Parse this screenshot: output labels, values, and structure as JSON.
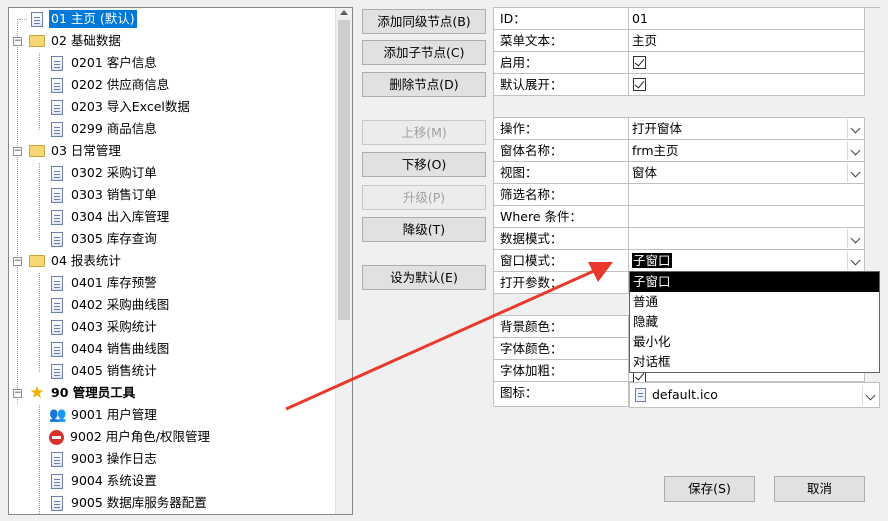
{
  "tree": {
    "nodes": [
      {
        "label": "01 主页 (默认)"
      },
      {
        "label": "02 基础数据"
      },
      {
        "label": "0201 客户信息"
      },
      {
        "label": "0202 供应商信息"
      },
      {
        "label": "0203 导入Excel数据"
      },
      {
        "label": "0299 商品信息"
      },
      {
        "label": "03 日常管理"
      },
      {
        "label": "0302 采购订单"
      },
      {
        "label": "0303 销售订单"
      },
      {
        "label": "0304 出入库管理"
      },
      {
        "label": "0305 库存查询"
      },
      {
        "label": "04 报表统计"
      },
      {
        "label": "0401 库存预警"
      },
      {
        "label": "0402 采购曲线图"
      },
      {
        "label": "0403 采购统计"
      },
      {
        "label": "0404 销售曲线图"
      },
      {
        "label": "0405 销售统计"
      },
      {
        "label": "90 管理员工具"
      },
      {
        "label": "9001 用户管理"
      },
      {
        "label": "9002 用户角色/权限管理"
      },
      {
        "label": "9003 操作日志"
      },
      {
        "label": "9004 系统设置"
      },
      {
        "label": "9005 数据库服务器配置"
      }
    ]
  },
  "buttons": {
    "add_sibling": "添加同级节点(B)",
    "add_child": "添加子节点(C)",
    "delete": "删除节点(D)",
    "move_up": "上移(M)",
    "move_down": "下移(O)",
    "promote": "升级(P)",
    "demote": "降级(T)",
    "set_default": "设为默认(E)"
  },
  "props": {
    "id_label": "ID：",
    "id_value": "01",
    "menu_text_label": "菜单文本：",
    "menu_text_value": "主页",
    "enabled_label": "启用：",
    "expand_label": "默认展开：",
    "operation_label": "操作：",
    "operation_value": "打开窗体",
    "form_name_label": "窗体名称：",
    "form_name_value": "frm主页",
    "view_label": "视图：",
    "view_value": "窗体",
    "filter_label": "筛选名称：",
    "where_label": "Where 条件：",
    "data_mode_label": "数据模式：",
    "window_mode_label": "窗口模式：",
    "window_mode_value": "子窗口",
    "open_args_label": "打开参数：",
    "back_color_label": "背景颜色：",
    "font_color_label": "字体颜色：",
    "font_bold_label": "字体加粗：",
    "icon_label": "图标：",
    "icon_value": "default.ico"
  },
  "dropdown": {
    "options": [
      "子窗口",
      "普通",
      "隐藏",
      "最小化",
      "对话框"
    ]
  },
  "footer": {
    "save": "保存(S)",
    "cancel": "取消"
  },
  "colors": {
    "selection": "#0078d7",
    "arrow": "#e8392b"
  }
}
